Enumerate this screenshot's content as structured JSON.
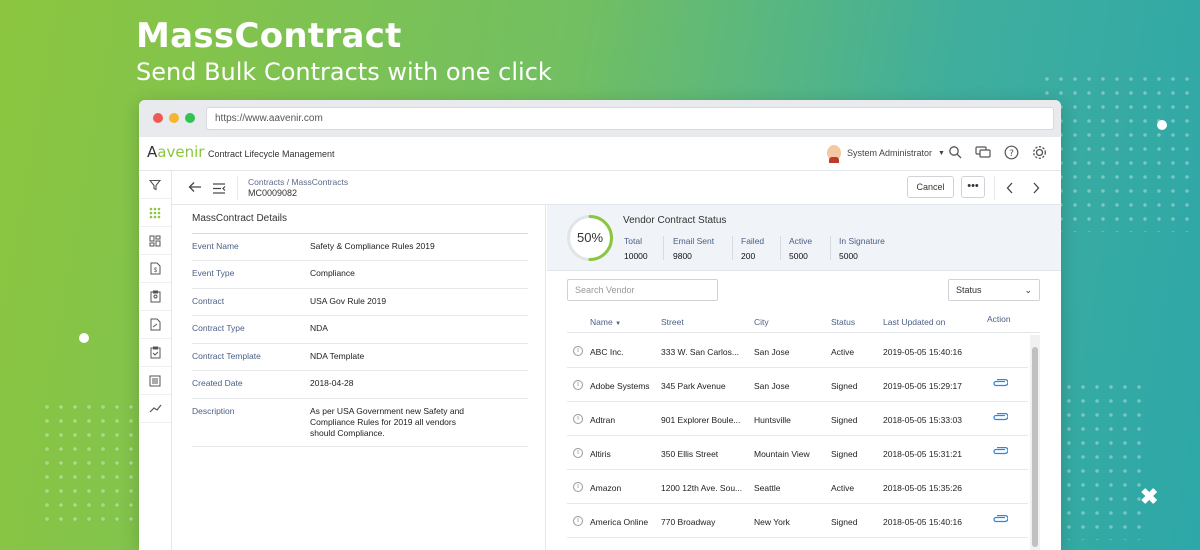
{
  "hero": {
    "title": "MassContract",
    "subtitle": "Send Bulk Contracts with one click"
  },
  "browser": {
    "url": "https://www.aavenir.com",
    "traffic_colors": [
      "#ee5a52",
      "#f5b531",
      "#2fc352"
    ]
  },
  "app": {
    "logo": "avenir",
    "logo_prefix": "A",
    "app_name": "Contract Lifecycle Management",
    "user": "System Administrator"
  },
  "breadcrumb": "Contracts / MassContracts",
  "contract_id": "MC0009082",
  "actions": {
    "cancel": "Cancel",
    "more": "•••"
  },
  "details": {
    "title": "MassContract Details",
    "rows": [
      {
        "k": "Event Name",
        "v": "Safety & Compliance Rules 2019"
      },
      {
        "k": "Event Type",
        "v": "Compliance"
      },
      {
        "k": "Contract",
        "v": "USA Gov Rule 2019"
      },
      {
        "k": "Contract Type",
        "v": "NDA"
      },
      {
        "k": "Contract Template",
        "v": "NDA Template"
      },
      {
        "k": "Created Date",
        "v": "2018-04-28"
      },
      {
        "k": "Description",
        "v": "As per USA Government new Safety and Compliance Rules for 2019 all vendors should Compliance."
      }
    ]
  },
  "status": {
    "title": "Vendor Contract Status",
    "percent": "50%",
    "progress": 0.5,
    "stats": [
      {
        "label": "Total",
        "value": "10000"
      },
      {
        "label": "Email Sent",
        "value": "9800"
      },
      {
        "label": "Failed",
        "value": "200"
      },
      {
        "label": "Active",
        "value": "5000"
      },
      {
        "label": "In Signature",
        "value": "5000"
      }
    ]
  },
  "search": {
    "placeholder": "Search Vendor"
  },
  "filter": {
    "label": "Status"
  },
  "table": {
    "headers": [
      "Name",
      "Street",
      "City",
      "Status",
      "Last Updated on",
      "Action"
    ],
    "rows": [
      {
        "name": "ABC Inc.",
        "street": "333 W. San Carlos...",
        "city": "San Jose",
        "status": "Active",
        "updated": "2019-05-05 15:40:16",
        "attach": false
      },
      {
        "name": "Adobe Systems",
        "street": "345 Park Avenue",
        "city": "San Jose",
        "status": "Signed",
        "updated": "2019-05-05 15:29:17",
        "attach": true
      },
      {
        "name": "Adtran",
        "street": "901 Explorer Boule...",
        "city": "Huntsville",
        "status": "Signed",
        "updated": "2018-05-05 15:33:03",
        "attach": true
      },
      {
        "name": "Altiris",
        "street": "350 Ellis Street",
        "city": "Mountain View",
        "status": "Signed",
        "updated": "2018-05-05 15:31:21",
        "attach": true
      },
      {
        "name": "Amazon",
        "street": "1200 12th Ave. Sou...",
        "city": "Seattle",
        "status": "Active",
        "updated": "2018-05-05 15:35:26",
        "attach": false
      },
      {
        "name": "America Online",
        "street": "770 Broadway",
        "city": "New York",
        "status": "Signed",
        "updated": "2018-05-05 15:40:16",
        "attach": true
      }
    ]
  }
}
